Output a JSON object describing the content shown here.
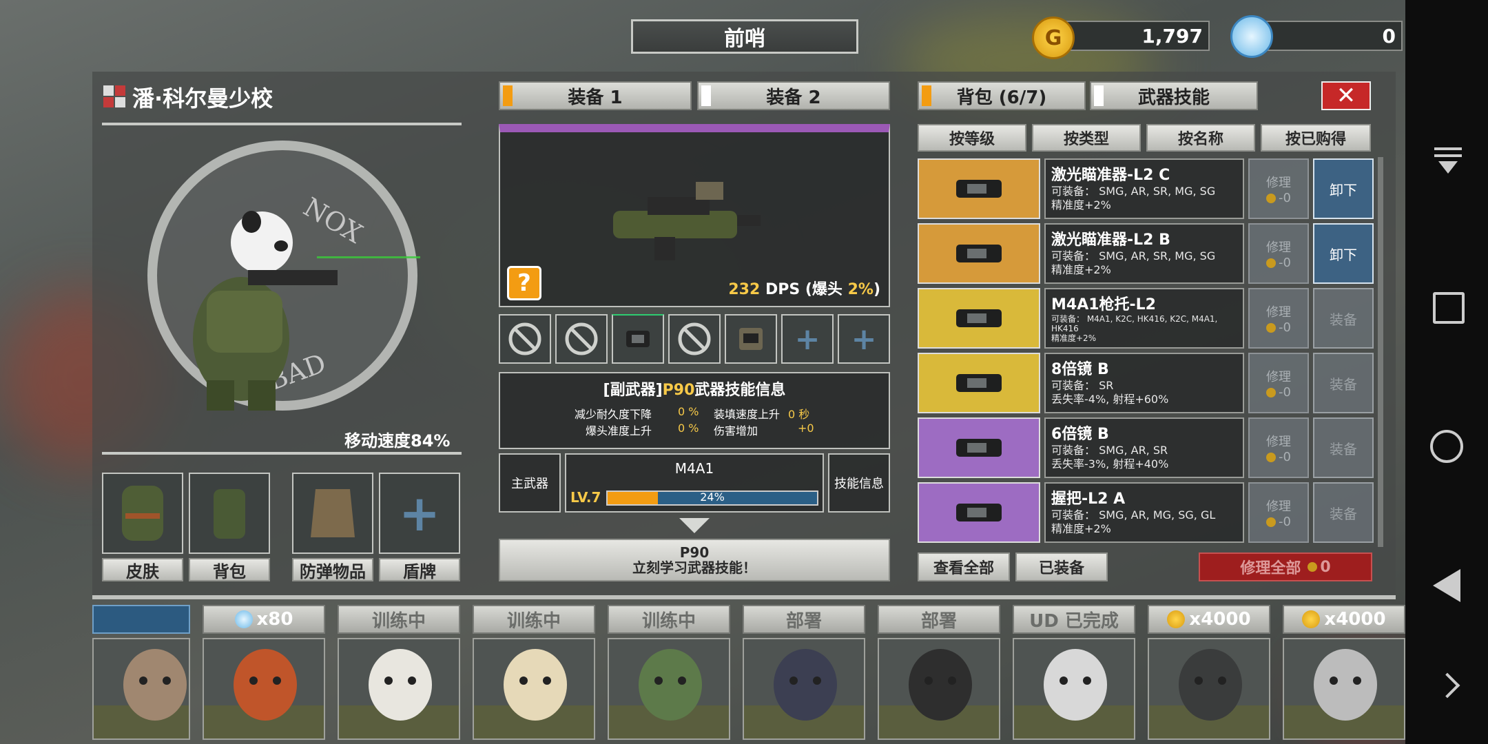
{
  "header": {
    "location_title": "前哨",
    "gold": "1,797",
    "gems": "0"
  },
  "character": {
    "name": "潘·科尔曼少校",
    "move_speed": "移动速度84%",
    "emblem_text_left": "NOX",
    "emblem_text_bottom": "BAD"
  },
  "gear_slots": [
    {
      "label": "皮肤"
    },
    {
      "label": "背包"
    },
    {
      "label": "防弹物品"
    },
    {
      "label": "盾牌"
    }
  ],
  "loadout_tabs": {
    "tab1": "装备 1",
    "tab2": "装备 2"
  },
  "weapon_preview": {
    "dps": "232",
    "dps_label": "DPS (爆头",
    "headshot": "2%",
    "dps_close": ")",
    "help": "?"
  },
  "skill_info": {
    "title_prefix": "[副武器]",
    "weapon_name": "P90",
    "title_suffix": "武器技能信息",
    "rows": [
      {
        "label": "减少耐久度下降",
        "value": "0 %",
        "label2": "装填速度上升",
        "value2": "0 秒"
      },
      {
        "label": "爆头准度上升",
        "value": "0 %",
        "label2": "伤害增加",
        "value2": "+0"
      }
    ]
  },
  "primary_weapon": {
    "tag": "主武器",
    "name": "M4A1",
    "level": "LV.7",
    "progress_text": "24%",
    "progress": 0.24,
    "skill_btn": "技能信息"
  },
  "learn_button": {
    "line1": "P90",
    "line2": "立刻学习武器技能！"
  },
  "right_tabs": {
    "tab1": "背包 (6/7)",
    "tab2": "武器技能"
  },
  "sort_buttons": [
    "按等级",
    "按类型",
    "按名称",
    "按已购得"
  ],
  "items": [
    {
      "name": "激光瞄准器-L2 C",
      "l1": "可装备： SMG, AR, SR, MG, SG",
      "l2": "精准度+2%",
      "tiny": false,
      "repair": "修理",
      "cost": "-0",
      "action": "卸下",
      "state": "unequip",
      "color": "#d69a3a"
    },
    {
      "name": "激光瞄准器-L2 B",
      "l1": "可装备： SMG, AR, SR, MG, SG",
      "l2": "精准度+2%",
      "tiny": false,
      "repair": "修理",
      "cost": "-0",
      "action": "卸下",
      "state": "unequip",
      "color": "#d69a3a"
    },
    {
      "name": "M4A1枪托-L2",
      "l1": "可装备： M4A1, K2C, HK416, K2C, M4A1, HK416",
      "l2": "精准度+2%",
      "tiny": true,
      "repair": "修理",
      "cost": "-0",
      "action": "装备",
      "state": "equip",
      "color": "#d9b93a"
    },
    {
      "name": "8倍镜 B",
      "l1": "可装备： SR",
      "l2": "丢失率-4%, 射程+60%",
      "tiny": false,
      "repair": "修理",
      "cost": "-0",
      "action": "装备",
      "state": "equip",
      "color": "#d9b93a"
    },
    {
      "name": "6倍镜 B",
      "l1": "可装备： SMG, AR, SR",
      "l2": "丢失率-3%, 射程+40%",
      "tiny": false,
      "repair": "修理",
      "cost": "-0",
      "action": "装备",
      "state": "equip",
      "color": "#9d6cc2"
    },
    {
      "name": "握把-L2 A",
      "l1": "可装备： SMG, AR, MG, SG, GL",
      "l2": "精准度+2%",
      "tiny": false,
      "repair": "修理",
      "cost": "-0",
      "action": "装备",
      "state": "equip",
      "color": "#9d6cc2"
    }
  ],
  "bottom_buttons": {
    "view_all": "查看全部",
    "equipped": "已装备",
    "repair_all": "修理全部",
    "repair_cost": "0"
  },
  "squad": [
    {
      "label": "",
      "kind": "selected"
    },
    {
      "label": "x80",
      "kind": "gem"
    },
    {
      "label": "训练中",
      "kind": "text"
    },
    {
      "label": "训练中",
      "kind": "text"
    },
    {
      "label": "训练中",
      "kind": "text"
    },
    {
      "label": "部署",
      "kind": "text"
    },
    {
      "label": "部署",
      "kind": "text"
    },
    {
      "label": "UD 已完成",
      "kind": "text"
    },
    {
      "label": "x4000",
      "kind": "coin"
    },
    {
      "label": "x4000",
      "kind": "coin"
    }
  ]
}
